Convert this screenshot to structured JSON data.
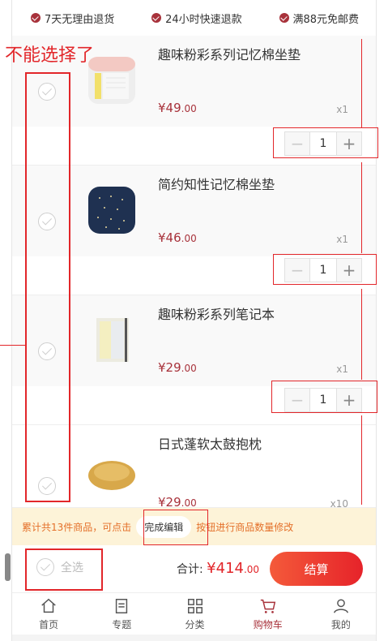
{
  "promo": [
    {
      "label": "7天无理由退货"
    },
    {
      "label": "24小时快速退款"
    },
    {
      "label": "满88元免邮费"
    }
  ],
  "items": [
    {
      "name": "趣味粉彩系列记忆棉坐垫",
      "price_main": "¥49",
      "price_dec": ".00",
      "qty_label": "x1",
      "qty": "1",
      "thumb": "pink-cushion"
    },
    {
      "name": "简约知性记忆棉坐垫",
      "price_main": "¥46",
      "price_dec": ".00",
      "qty_label": "x1",
      "qty": "1",
      "thumb": "navy-cushion"
    },
    {
      "name": "趣味粉彩系列笔记本",
      "price_main": "¥29",
      "price_dec": ".00",
      "qty_label": "x1",
      "qty": "1",
      "thumb": "notebook"
    },
    {
      "name": "日式蓬软太鼓抱枕",
      "price_main": "¥29",
      "price_dec": ".00",
      "qty_label": "x10",
      "thumb": "round-pillow"
    }
  ],
  "tip": {
    "before": "累计共13件商品，可点击",
    "button": "完成编辑",
    "after": "按钮进行商品数量修改"
  },
  "checkout": {
    "select_all": "全选",
    "total_label": "合计:",
    "total_main": "¥414",
    "total_dec": ".00",
    "button": "结算"
  },
  "tabs": [
    {
      "label": "首页",
      "icon": "home-icon"
    },
    {
      "label": "专题",
      "icon": "topic-icon"
    },
    {
      "label": "分类",
      "icon": "category-icon"
    },
    {
      "label": "购物车",
      "icon": "cart-icon",
      "active": true
    },
    {
      "label": "我的",
      "icon": "user-icon"
    }
  ],
  "annotation": {
    "note": "不能选择了"
  },
  "colors": {
    "brand": "#a8323b",
    "accent": "#e2262a",
    "tip_bg": "#fdf3d8"
  }
}
